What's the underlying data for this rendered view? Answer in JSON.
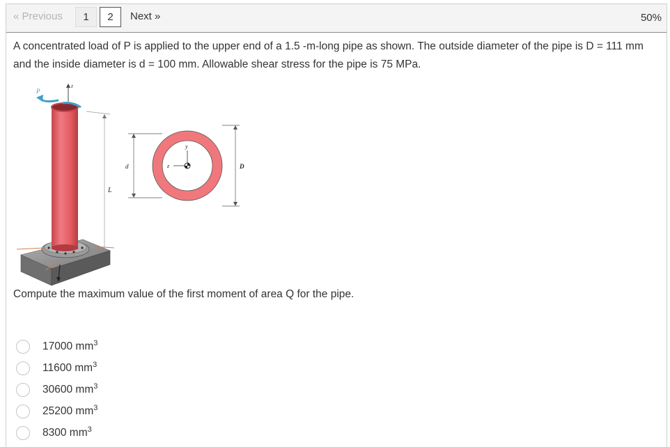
{
  "pagination": {
    "previous_label": "« Previous",
    "pages": [
      "1",
      "2"
    ],
    "current_page": "2",
    "next_label": "Next »",
    "progress_label": "50%"
  },
  "question": {
    "text": "A concentrated load of P is applied to the upper end of a 1.5 -m-long pipe as shown. The outside diameter of the pipe is D = 111 mm and the inside diameter is d = 100 mm. Allowable shear stress for the pipe is 75 MPa.",
    "prompt": "Compute the maximum value of the first moment of area Q for the pipe."
  },
  "figure": {
    "labels": {
      "P": "P",
      "z_top": "z",
      "L": "L",
      "d": "d",
      "D": "D",
      "y": "y",
      "z": "z"
    },
    "colors": {
      "pipe": "#e9656b",
      "ring": "#f0787c",
      "base": "#8a8a8a"
    }
  },
  "options": [
    {
      "value": "17000 mm",
      "exp": "3"
    },
    {
      "value": "11600 mm",
      "exp": "3"
    },
    {
      "value": "30600 mm",
      "exp": "3"
    },
    {
      "value": "25200 mm",
      "exp": "3"
    },
    {
      "value": "8300 mm",
      "exp": "3"
    }
  ]
}
